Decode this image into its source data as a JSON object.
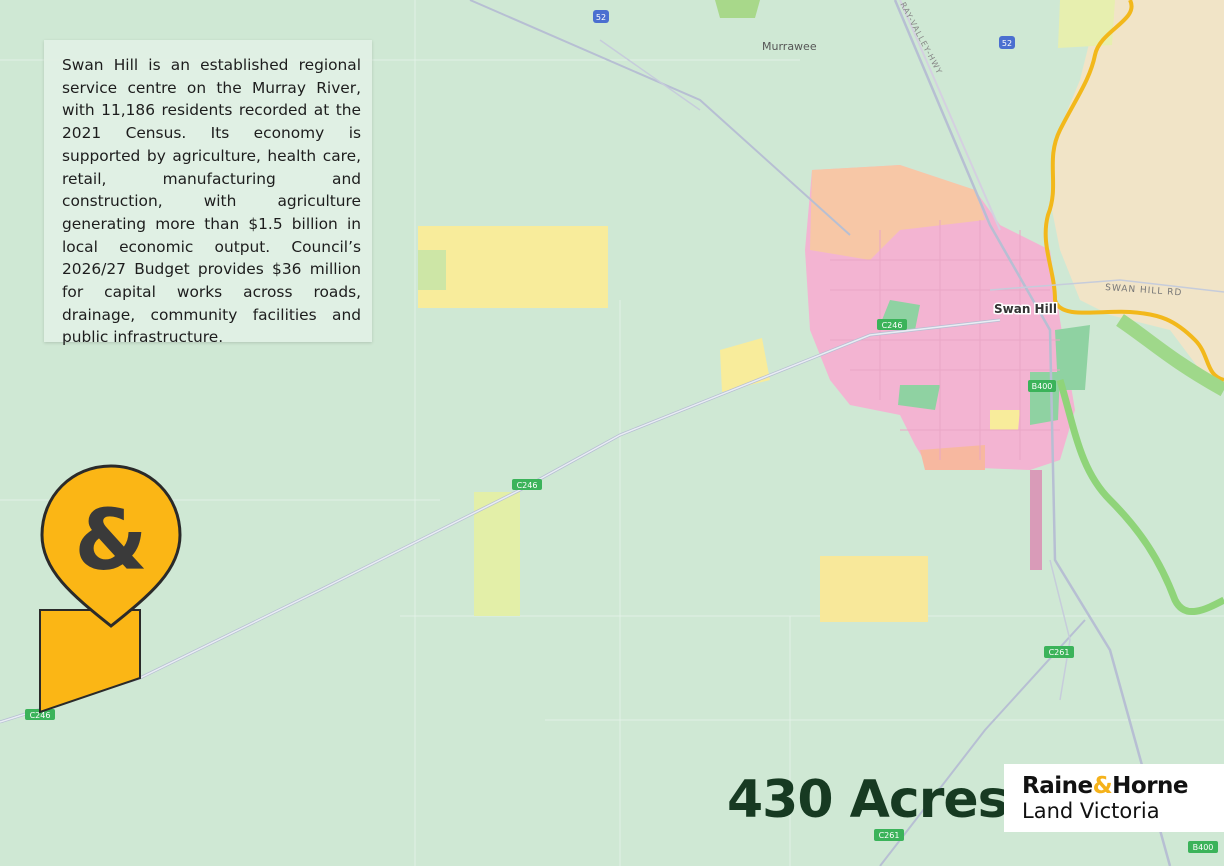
{
  "map": {
    "place_labels": {
      "murrawee": "Murrawee",
      "swan_hill": "Swan Hill"
    },
    "road_labels": {
      "swan_hill_rd": "SWAN HILL RD",
      "valley_hwy": "RAY-VALLEY-HWY"
    },
    "route_shields": {
      "c246_a": "C246",
      "c246_b": "C246",
      "c246_c": "C246",
      "r52_a": "52",
      "r52_b": "52",
      "b400_a": "B400",
      "b400_b": "B400",
      "c261_a": "C261",
      "c261_b": "C261"
    }
  },
  "info": {
    "text": "Swan Hill is an established regional service centre on the Murray River, with 11,186 residents recorded at the 2021 Census. Its economy is supported by agriculture, health care, retail, manufacturing and construction, with agriculture generating more than $1.5 billion in local economic output. Council’s 2026/27 Budget provides $36 million for capital works across roads, drainage, community facilities and public infrastructure."
  },
  "headline": {
    "area": "430 Acres",
    "asterisk": "*"
  },
  "brand": {
    "part1": "Raine",
    "amp": "&",
    "part2": "Horne",
    "line2": "Land Victoria"
  },
  "marker": {
    "glyph": "&"
  },
  "colors": {
    "map_bg": "#cfe8d4",
    "marker": "#fbb615",
    "heading": "#173a22",
    "river": "#f2b81b"
  }
}
